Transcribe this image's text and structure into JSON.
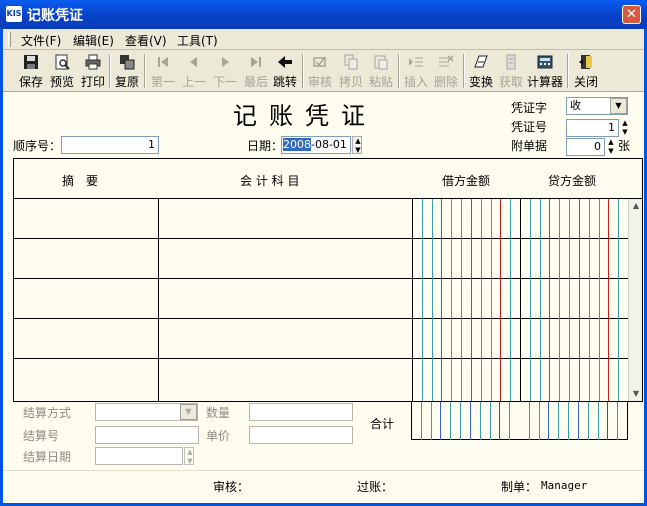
{
  "window": {
    "title": "记账凭证",
    "app_icon": "KIS",
    "close_glyph": "✕"
  },
  "menu": [
    "文件(F)",
    "编辑(E)",
    "查看(V)",
    "工具(T)"
  ],
  "toolbar": [
    {
      "label": "保存",
      "icon": "save-icon",
      "enabled": true
    },
    {
      "label": "预览",
      "icon": "preview-icon",
      "enabled": true
    },
    {
      "label": "打印",
      "icon": "print-icon",
      "enabled": true
    },
    {
      "label": "复原",
      "icon": "restore-icon",
      "enabled": true
    },
    {
      "label": "第一",
      "icon": "first-icon",
      "enabled": false
    },
    {
      "label": "上一",
      "icon": "prev-icon",
      "enabled": false
    },
    {
      "label": "下一",
      "icon": "next-icon",
      "enabled": false
    },
    {
      "label": "最后",
      "icon": "last-icon",
      "enabled": false
    },
    {
      "label": "跳转",
      "icon": "jump-icon",
      "enabled": true
    },
    {
      "label": "审核",
      "icon": "audit-icon",
      "enabled": false
    },
    {
      "label": "拷贝",
      "icon": "copy-icon",
      "enabled": false
    },
    {
      "label": "粘贴",
      "icon": "paste-icon",
      "enabled": false
    },
    {
      "label": "插入",
      "icon": "insert-icon",
      "enabled": false
    },
    {
      "label": "删除",
      "icon": "delete-icon",
      "enabled": false
    },
    {
      "label": "变换",
      "icon": "transform-icon",
      "enabled": true
    },
    {
      "label": "获取",
      "icon": "fetch-icon",
      "enabled": false
    },
    {
      "label": "计算器",
      "icon": "calculator-icon",
      "enabled": true
    },
    {
      "label": "关闭",
      "icon": "close-door-icon",
      "enabled": true
    }
  ],
  "voucher": {
    "heading": "记账凭证",
    "seq_label": "顺序号：",
    "seq_value": "1",
    "date_label": "日期：",
    "date_year": "2008",
    "date_rest": "-08-01",
    "type_label": "凭证字",
    "type_value": "收",
    "number_label": "凭证号",
    "number_value": "1",
    "attach_label": "附单据",
    "attach_value": "0",
    "attach_unit": "张"
  },
  "grid": {
    "headers": [
      "摘　要",
      "会 计 科 目",
      "借方金额",
      "贷方金额"
    ],
    "rows": 5
  },
  "bottom": {
    "settle_method": "结算方式",
    "settle_no": "结算号",
    "settle_date": "结算日期",
    "quantity": "数量",
    "unit_price": "单价",
    "total": "合计"
  },
  "status": {
    "audit": "审核：",
    "post": "过账：",
    "maker_label": "制单：",
    "maker_value": "Manager"
  },
  "colors": {
    "title_bar": "#0842c8",
    "teal_line": "#3a9ca8",
    "blue_line": "#3a5fd8",
    "red_line": "#c81e1e"
  }
}
